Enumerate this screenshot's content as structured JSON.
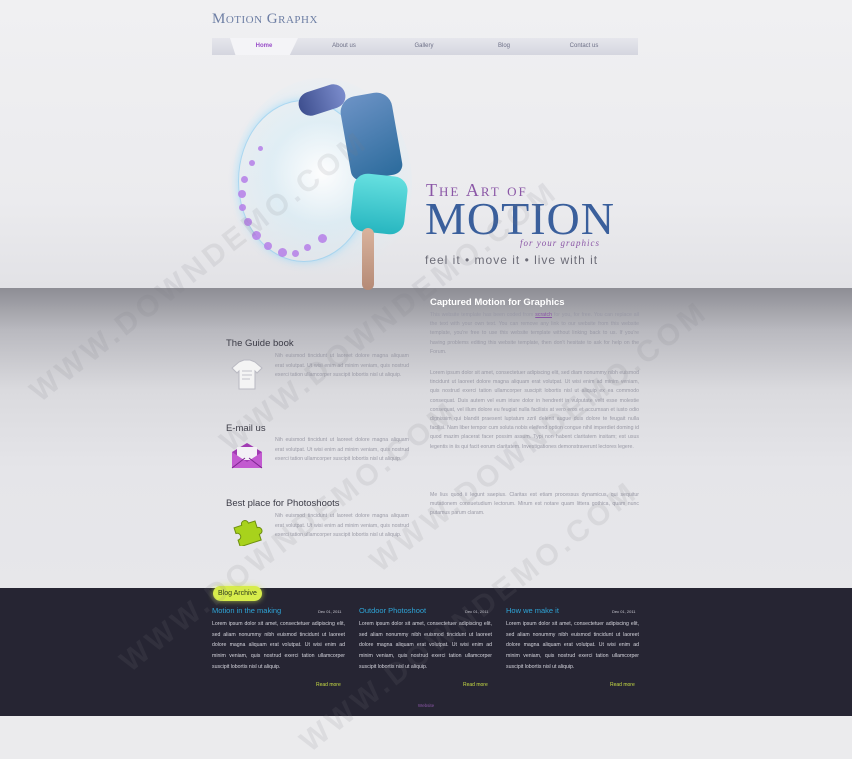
{
  "brand": {
    "logo": "Motion Graphx"
  },
  "nav": {
    "items": [
      {
        "label": "Home",
        "active": true
      },
      {
        "label": "About us"
      },
      {
        "label": "Gallery"
      },
      {
        "label": "Blog"
      },
      {
        "label": "Contact us"
      }
    ]
  },
  "hero": {
    "pre_title": "The Art of",
    "title": "MOTION",
    "subtitle": "for your graphics",
    "tagline": "feel it • move it • live with it"
  },
  "features": [
    {
      "title": "The Guide book",
      "icon": "shirt-icon",
      "text": "Nih euismod tincidunt ut laoreet dolore magna aliquam erat volutpat. Ut wisi enim ad minim veniam, quis nostrud exerci tation ullamcorper suscipit lobortis nisl ut aliquip."
    },
    {
      "title": "E-mail us",
      "icon": "envelope-icon",
      "text": "Nih euismod tincidunt ut laoreet dolore magna aliquam erat volutpat. Ut wisi enim ad minim veniam, quis nostrud exerci tation ullamcorper suscipit lobortis nisl ut aliquip."
    },
    {
      "title": "Best place for Photoshoots",
      "icon": "puzzle-icon",
      "text": "Nih euismod tincidunt ut laoreet dolore magna aliquam erat volutpat. Ut wisi enim ad minim veniam, quis nostrud exerci tation ullamcorper suscipit lobortis nisl ut aliquip."
    }
  ],
  "main": {
    "title": "Captured Motion for Graphics",
    "intro_before": "This website template has been coded from ",
    "intro_link": "scratch",
    "intro_after": " for you, for free. You can replace all the text with your own text. You can remove any link to our website from this website template, you're free to use this website template without linking back to us. If you're having problems editing this website template, then don't hesitate to ask for help on the Forum.",
    "para2": "Lorem ipsum dolor sit amet, consectetuer adipiscing elit, sed diam nonummy nibh euismod tincidunt ut laoreet dolore magna aliquam erat volutpat. Ut wisi enim ad minim veniam, quis nostrud exerci tation ullamcorper suscipit lobortis nisl ut aliquip ex ea commodo consequat. Duis autem vel eum iriure dolor in hendrerit in vulputate velit esse molestie consequat, vel illum dolore eu feugiat nulla facilisis at vero eros et accumsan et iusto odio dignissim qui blandit praesent luptatum zzril delenit augue duis dolore te feugait nulla facilisi. Nam liber tempor cum soluta nobis eleifend option congue nihil imperdiet doming id quod mazim placerat facer possim assum. Typi non habent claritatem insitam; est usus legentis in iis qui facit eorum claritatem. Investigationes demonstraverunt lectores legere.",
    "para3": "Me lius quod ii legunt saepius. Claritas est etiam processus dynamicus, qui sequitur mutationem consuetudium lectorum. Mirum est notare quam littera gothica, quam nunc putamus parum claram."
  },
  "archive": {
    "label": "Blog Archive",
    "more_label": "Read more",
    "posts": [
      {
        "title": "Motion in the making",
        "date": "Dec 01, 2011",
        "text": "Lorem ipsum dolor sit amet, consectetuer adipiscing elit, sed aliam nonummy nibh euismod tincidunt ut laoreet dolore magna aliquam erat volutpat. Ut wisi enim ad minim veniam, quis nostrud exerci tation ullamcorper suscipit lobortis nisl ut aliquip."
      },
      {
        "title": "Outdoor Photoshoot",
        "date": "Dec 01, 2011",
        "text": "Lorem ipsum dolor sit amet, consectetuer adipiscing elit, sed aliam nonummy nibh euismod tincidunt ut laoreet dolore magna aliquam erat volutpat. Ut wisi enim ad minim veniam, quis nostrud exerci tation ullamcorper suscipit lobortis nisl ut aliquip."
      },
      {
        "title": "How we make it",
        "date": "Dec 01, 2011",
        "text": "Lorem ipsum dolor sit amet, consectetuer adipiscing elit, sed aliam nonummy nibh euismod tincidunt ut laoreet dolore magna aliquam erat volutpat. Ut wisi enim ad minim veniam, quis nostrud exerci tation ullamcorper suscipit lobortis nisl ut aliquip."
      }
    ]
  },
  "footer": {
    "link": "Website"
  },
  "watermark": "WWW.DOWNDEMO.COM",
  "colors": {
    "accent_purple": "#8a56a6",
    "motion_blue": "#3a5f9c",
    "archive_green": "#d7ec4b",
    "post_title_blue": "#2ea4d6",
    "dark_band": "#262533"
  }
}
